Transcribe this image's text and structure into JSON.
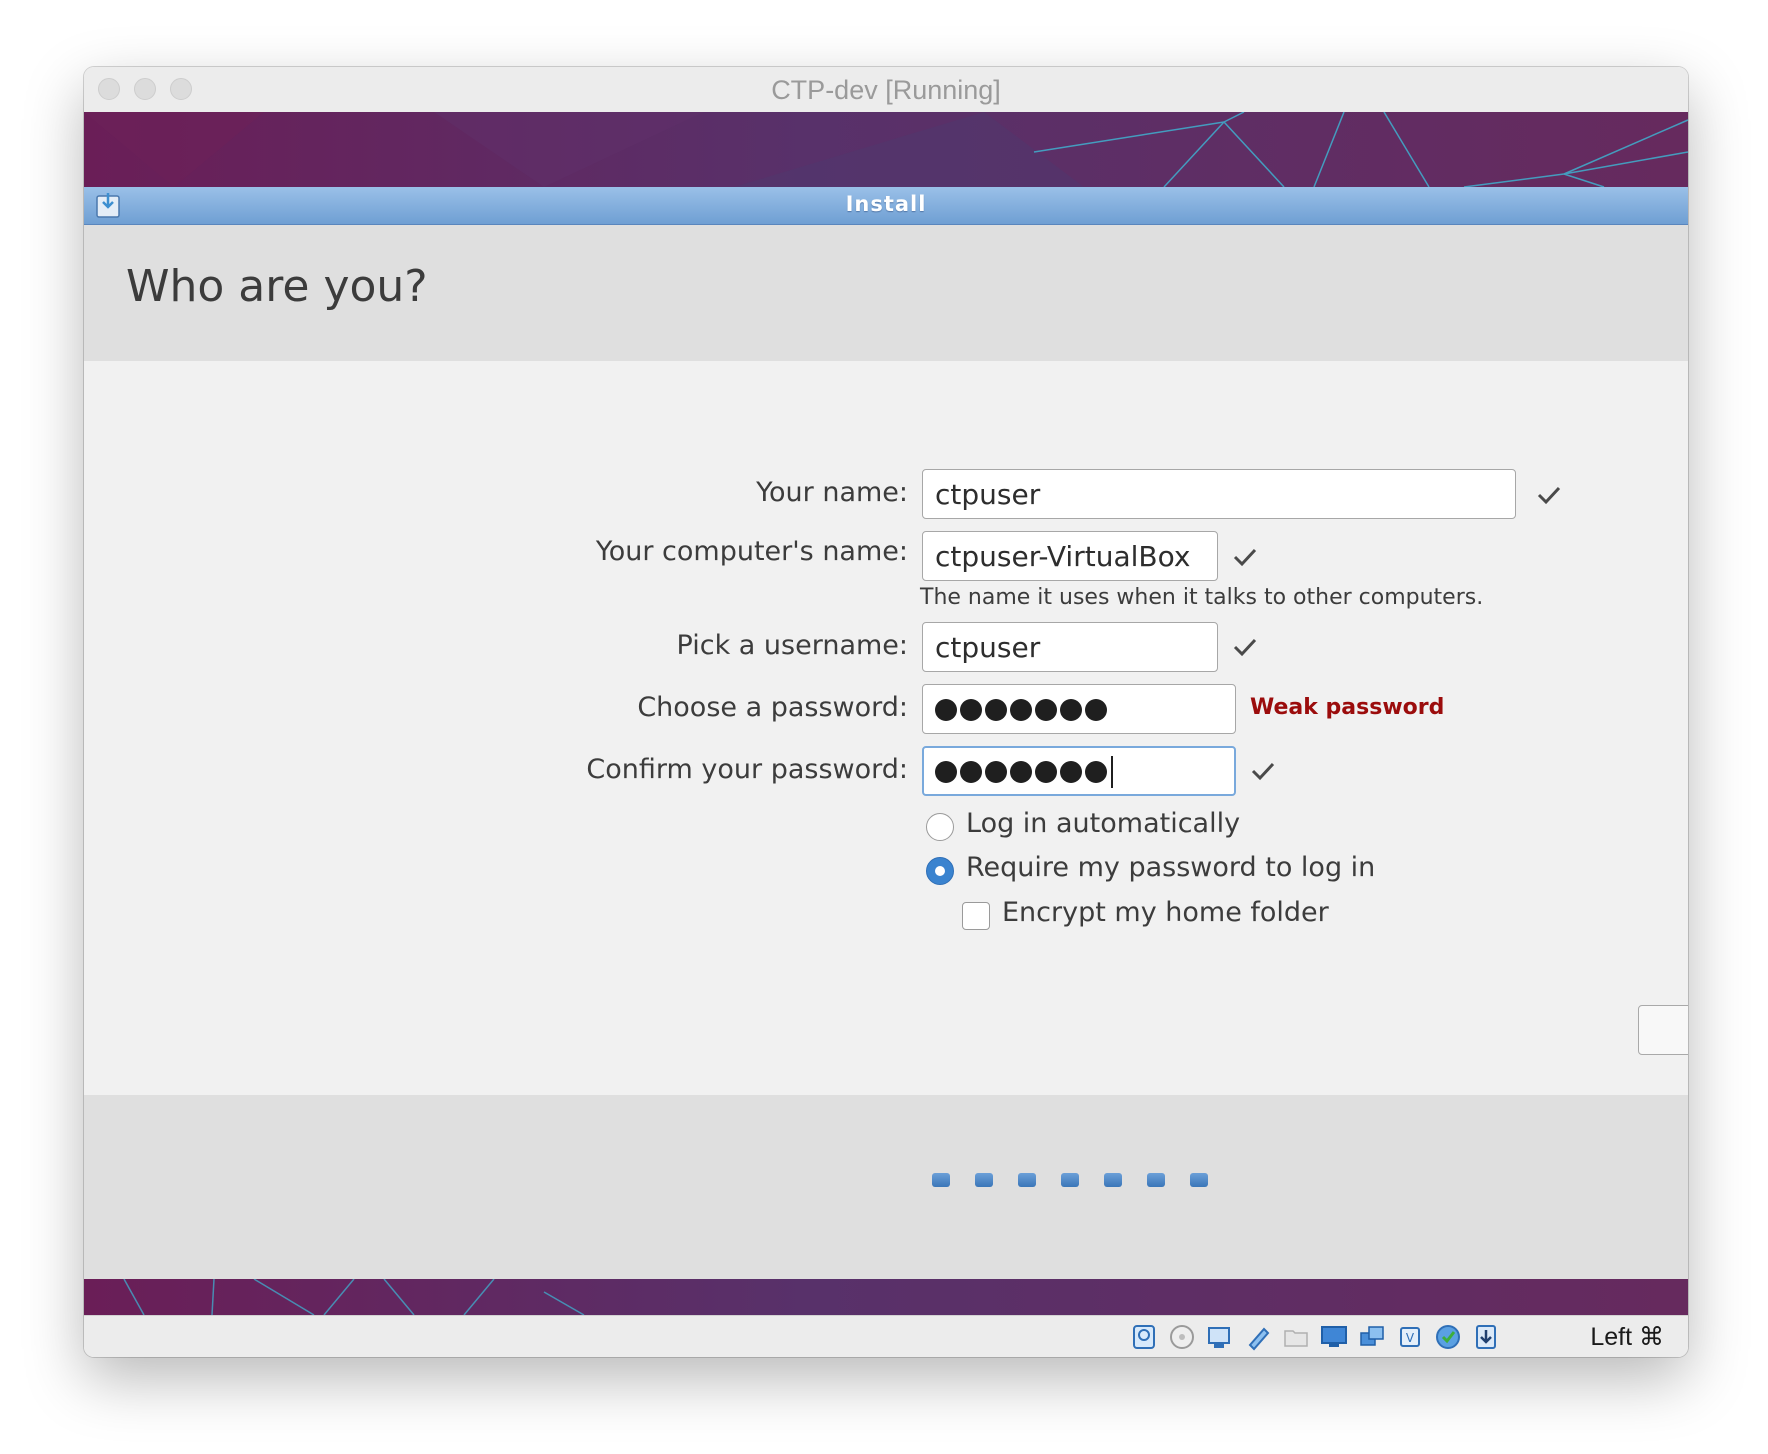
{
  "window": {
    "title": "CTP-dev [Running]"
  },
  "installer": {
    "title": "Install",
    "page_title": "Who are you?"
  },
  "form": {
    "your_name_label": "Your name:",
    "your_name_value": "ctpuser",
    "computer_name_label": "Your computer's name:",
    "computer_name_value": "ctpuser-VirtualBox",
    "computer_name_hint": "The name it uses when it talks to other computers.",
    "username_label": "Pick a username:",
    "username_value": "ctpuser",
    "password_label": "Choose a password:",
    "password_strength": "Weak password",
    "confirm_label": "Confirm your password:"
  },
  "options": {
    "login_auto": "Log in automatically",
    "login_require": "Require my password to log in",
    "encrypt_home": "Encrypt my home folder",
    "selected": "login_require",
    "encrypt_checked": false
  },
  "progress": {
    "total_steps": 7
  },
  "statusbar": {
    "host_key": "Left ⌘",
    "icons": [
      "hard-disk-icon",
      "optical-drive-icon",
      "audio-icon",
      "usb-icon",
      "shared-folders-icon",
      "display-icon",
      "network-icon",
      "cpu-icon",
      "video-capture-icon",
      "mouse-integration-icon"
    ]
  },
  "colors": {
    "accent_blue": "#3a83cf",
    "install_titlebar": "#7ea9d9",
    "weak_password": "#9b0c0c",
    "wallpaper_purple": "#5a2a5e"
  }
}
